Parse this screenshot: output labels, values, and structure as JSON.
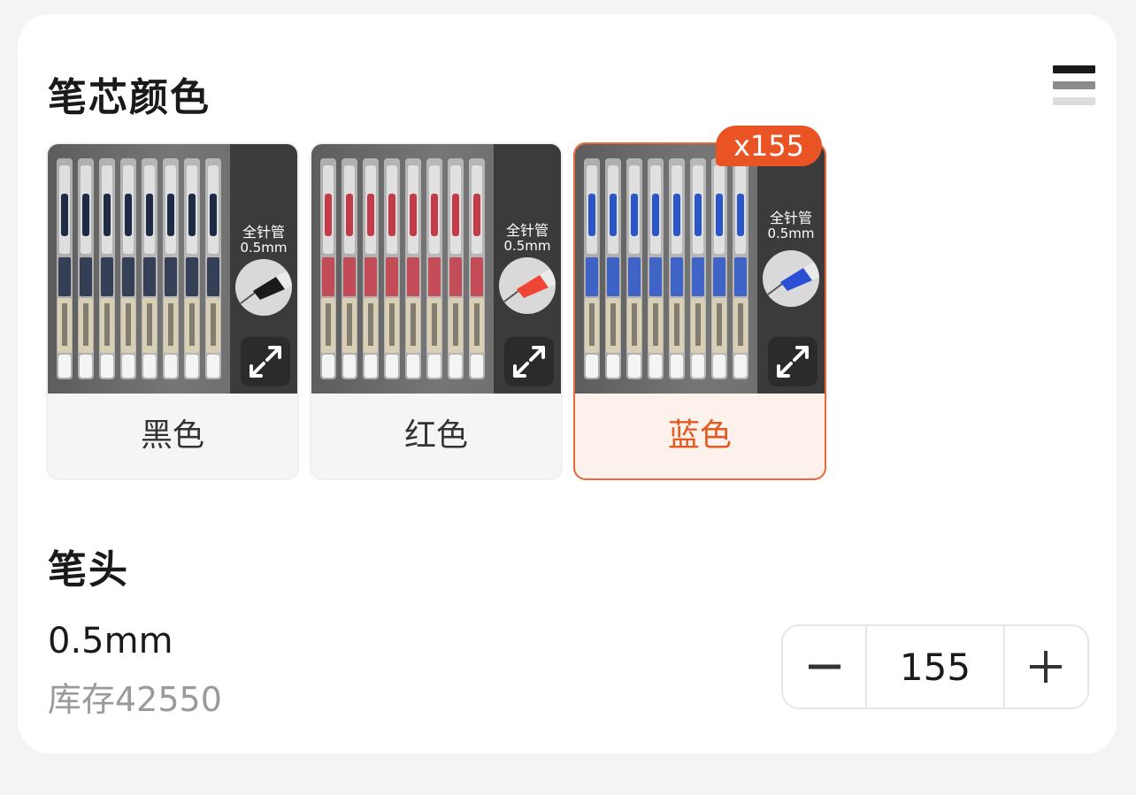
{
  "color_section": {
    "title": "笔芯颜色",
    "options": [
      {
        "label": "黑色",
        "ink": "#1f2a44",
        "tube_text": "全针管",
        "tip_size": "0.5mm",
        "tip_color": "#1a1a1a",
        "selected": false
      },
      {
        "label": "红色",
        "ink": "#c43b48",
        "tube_text": "全针管",
        "tip_size": "0.5mm",
        "tip_color": "#ef4535",
        "selected": false
      },
      {
        "label": "蓝色",
        "ink": "#2a56c9",
        "tube_text": "全针管",
        "tip_size": "0.5mm",
        "tip_color": "#2a4fd4",
        "selected": true
      }
    ],
    "selected_badge": "x155"
  },
  "tip_section": {
    "title": "笔头",
    "spec": "0.5mm",
    "stock": "库存42550",
    "quantity": "155"
  },
  "colors": {
    "accent": "#ea5324",
    "selected_text": "#e25a22",
    "selected_bg": "#fdf1ec"
  }
}
